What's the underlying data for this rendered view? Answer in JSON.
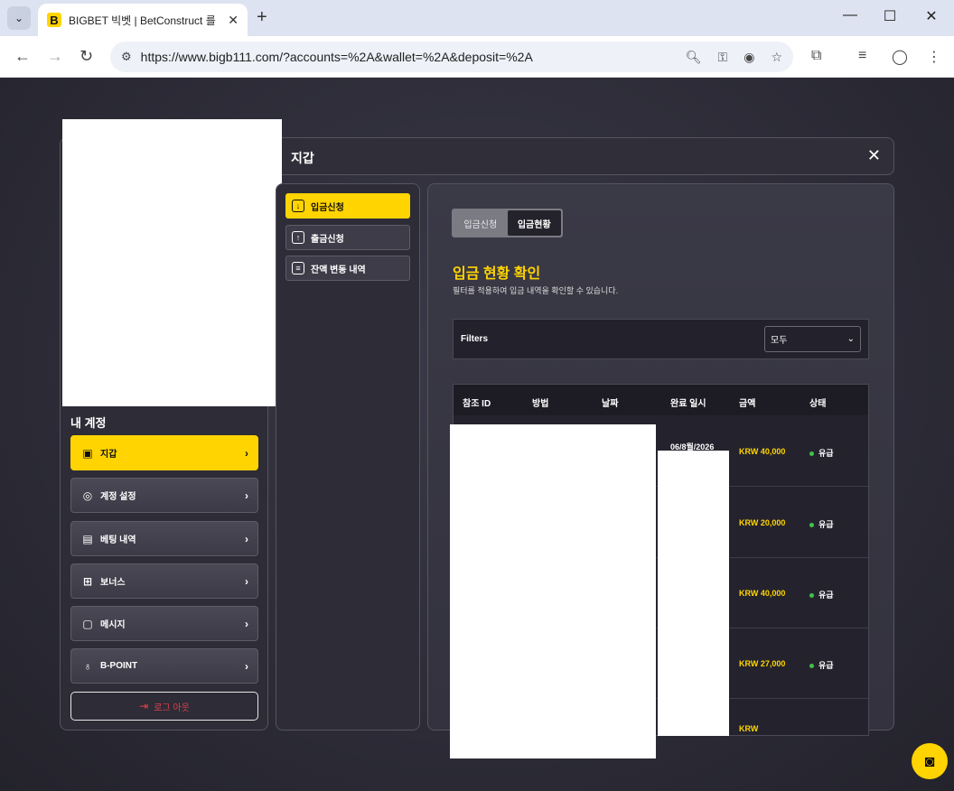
{
  "browser": {
    "tab_title": "BIGBET 빅벳 | BetConstruct 를",
    "favicon_letter": "B",
    "url": "https://www.bigb111.com/?accounts=%2A&wallet=%2A&deposit=%2A"
  },
  "modal": {
    "title": "지갑"
  },
  "account": {
    "title": "내 계정",
    "items": [
      {
        "label": "지갑",
        "icon": "wallet-icon"
      },
      {
        "label": "계정 설정",
        "icon": "user-icon"
      },
      {
        "label": "베팅 내역",
        "icon": "receipt-icon"
      },
      {
        "label": "보너스",
        "icon": "gift-icon"
      },
      {
        "label": "메시지",
        "icon": "message-icon"
      },
      {
        "label": "B-POINT",
        "icon": "bulb-icon"
      }
    ],
    "logout_label": "로그 아웃"
  },
  "wallet_menu": [
    {
      "label": "입금신청",
      "icon": "download-icon"
    },
    {
      "label": "출금신청",
      "icon": "upload-icon"
    },
    {
      "label": "잔액 변동 내역",
      "icon": "history-icon"
    }
  ],
  "segment": {
    "option1": "입금신청",
    "option2": "입금현황"
  },
  "status_section": {
    "title": "입금 현황 확인",
    "subtitle": "필터를 적용하여 입금 내역을 확인할 수 있습니다."
  },
  "filters": {
    "label": "Filters",
    "selected": "모두"
  },
  "table": {
    "headers": [
      "참조 ID",
      "방법",
      "날짜",
      "완료 일시",
      "금액",
      "상태"
    ],
    "rows": [
      {
        "completed": "06/8월/2026",
        "amount": "KRW 40,000",
        "status": "유급"
      },
      {
        "completed": "",
        "amount": "KRW 20,000",
        "status": "유급"
      },
      {
        "completed": "",
        "amount": "KRW 40,000",
        "status": "유급"
      },
      {
        "completed": "",
        "amount": "KRW 27,000",
        "status": "유급"
      },
      {
        "completed": "",
        "amount": "KRW",
        "status": ""
      }
    ]
  },
  "colors": {
    "accent": "#ffd400",
    "status_ok": "#3ec24a",
    "logout": "#e0404a"
  }
}
